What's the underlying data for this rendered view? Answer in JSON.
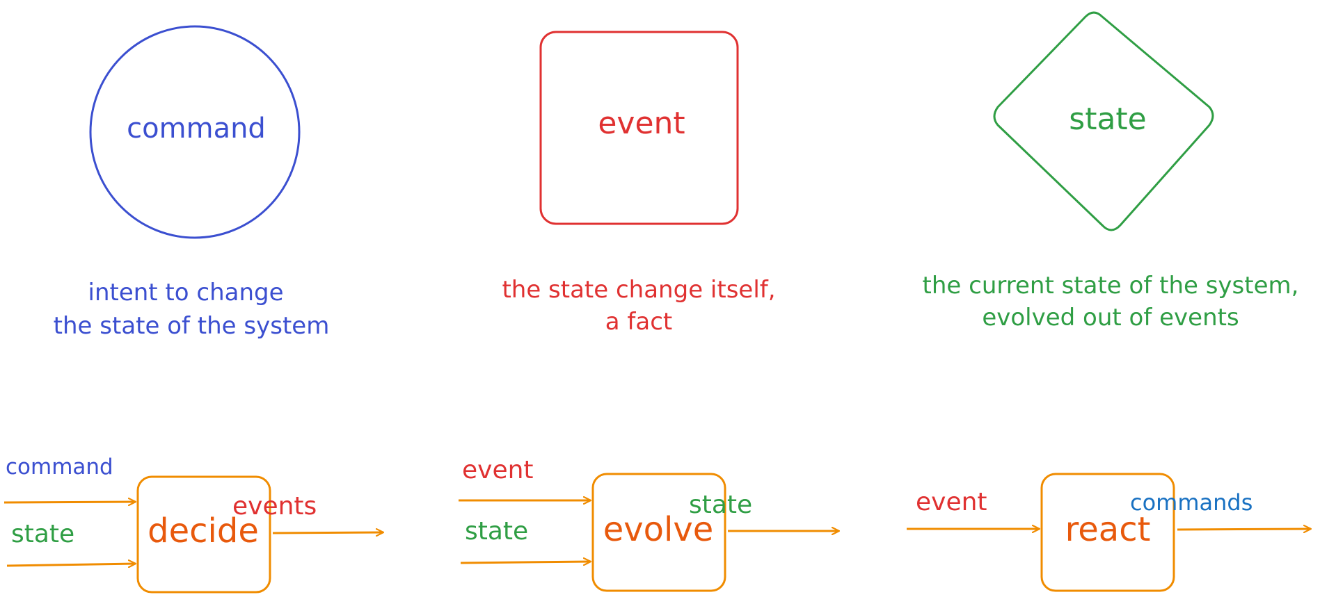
{
  "colors": {
    "command": "#3b4fd0",
    "event": "#e03131",
    "state": "#2f9e44",
    "function_box": "#f08c00",
    "function_text": "#e8590c",
    "commands_out": "#1971c2"
  },
  "concepts": [
    {
      "id": "command",
      "shape": "ellipse",
      "label": "command",
      "description_lines": [
        "intent to change",
        "the state of the system"
      ]
    },
    {
      "id": "event",
      "shape": "rounded-rectangle",
      "label": "event",
      "description_lines": [
        "the state change itself,",
        "a fact"
      ]
    },
    {
      "id": "state",
      "shape": "diamond",
      "label": "state",
      "description_lines": [
        "the current state of the system,",
        "evolved out of events"
      ]
    }
  ],
  "functions": [
    {
      "id": "decide",
      "label": "decide",
      "inputs": [
        {
          "label": "command",
          "color_key": "command"
        },
        {
          "label": "state",
          "color_key": "state"
        }
      ],
      "output": {
        "label": "events",
        "color_key": "event"
      }
    },
    {
      "id": "evolve",
      "label": "evolve",
      "inputs": [
        {
          "label": "event",
          "color_key": "event"
        },
        {
          "label": "state",
          "color_key": "state"
        }
      ],
      "output": {
        "label": "state",
        "color_key": "state"
      }
    },
    {
      "id": "react",
      "label": "react",
      "inputs": [
        {
          "label": "event",
          "color_key": "event"
        }
      ],
      "output": {
        "label": "commands",
        "color_key": "commands_out"
      }
    }
  ]
}
